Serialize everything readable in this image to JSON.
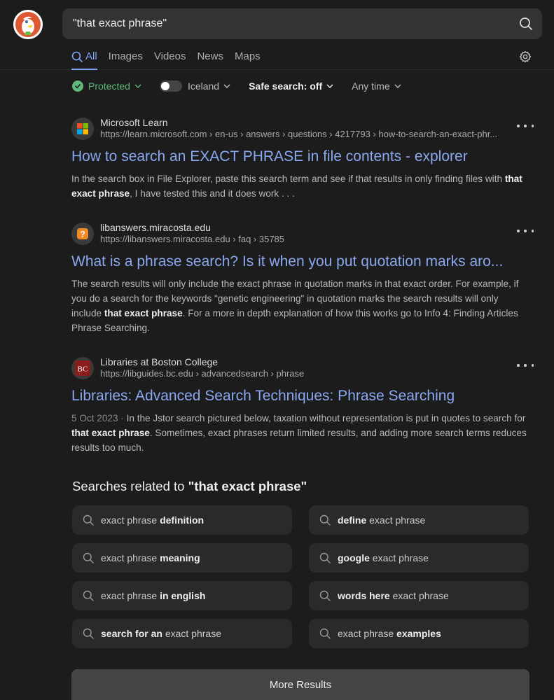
{
  "search": {
    "query": "\"that exact phrase\""
  },
  "tabs": [
    {
      "label": "All"
    },
    {
      "label": "Images"
    },
    {
      "label": "Videos"
    },
    {
      "label": "News"
    },
    {
      "label": "Maps"
    }
  ],
  "filters": {
    "protected": "Protected",
    "region": "Iceland",
    "safe_search": "Safe search: off",
    "time": "Any time"
  },
  "results": [
    {
      "site_name": "Microsoft Learn",
      "url": "https://learn.microsoft.com › en-us › answers › questions › 4217793 › how-to-search-an-exact-phr...",
      "title": "How to search an EXACT PHRASE in file contents - explorer",
      "snippet_before": "In the search box in File Explorer, paste this search term and see if that results in only finding files with ",
      "snippet_bold": "that exact phrase",
      "snippet_after": ", I have tested this and it does work . . .",
      "favicon_colors": [
        "#f25022",
        "#7fba00",
        "#00a4ef",
        "#ffb900"
      ]
    },
    {
      "site_name": "libanswers.miracosta.edu",
      "url": "https://libanswers.miracosta.edu › faq › 35785",
      "title": "What is a phrase search? Is it when you put quotation marks aro...",
      "snippet_before": "The search results will only include the exact phrase in quotation marks in that exact order. For example, if you do a search for the keywords \"genetic engineering\" in quotation marks the search results will only include ",
      "snippet_bold": "that exact phrase",
      "snippet_after": ". For a more in depth explanation of how this works go to Info 4: Finding Articles Phrase Searching.",
      "favicon_colors": [
        "#f08a24"
      ]
    },
    {
      "site_name": "Libraries at Boston College",
      "url": "https://libguides.bc.edu › advancedsearch › phrase",
      "title": "Libraries: Advanced Search Techniques: Phrase Searching",
      "date": "5 Oct 2023",
      "date_sep": " · ",
      "snippet_before": "In the Jstor search pictured below, taxation without representation is put in quotes to search for ",
      "snippet_bold": "that exact phrase",
      "snippet_after": ". Sometimes, exact phrases return limited results, and adding more search terms reduces results too much.",
      "favicon_text": "BC",
      "favicon_colors": [
        "#8a1c1c"
      ]
    }
  ],
  "related": {
    "heading_prefix": "Searches related to ",
    "heading_query": "\"that exact phrase\"",
    "items": [
      {
        "plain": "exact phrase ",
        "bold": "definition",
        "bold_first": false
      },
      {
        "plain": " exact phrase",
        "bold": "define",
        "bold_first": true
      },
      {
        "plain": "exact phrase ",
        "bold": "meaning",
        "bold_first": false
      },
      {
        "plain": " exact phrase",
        "bold": "google",
        "bold_first": true
      },
      {
        "plain": "exact phrase ",
        "bold": "in english",
        "bold_first": false
      },
      {
        "plain": " exact phrase",
        "bold": "words here",
        "bold_first": true
      },
      {
        "plain": " exact phrase",
        "bold": "search for an",
        "bold_first": true
      },
      {
        "plain": "exact phrase ",
        "bold": "examples",
        "bold_first": false
      }
    ]
  },
  "more_results": "More Results"
}
